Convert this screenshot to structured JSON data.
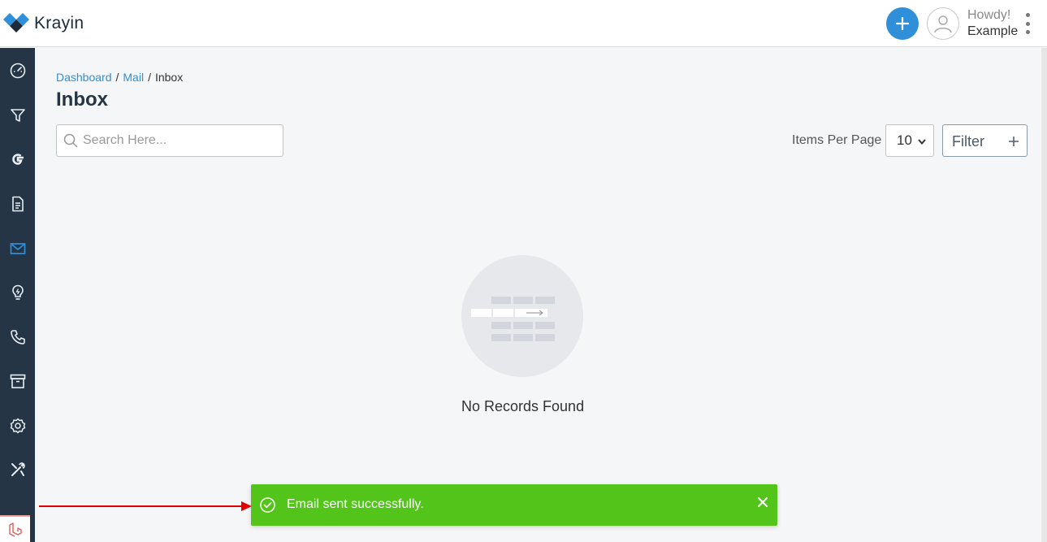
{
  "app": {
    "name": "Krayin"
  },
  "header": {
    "greeting": "Howdy!",
    "user": "Example"
  },
  "sidebar": {
    "items": [
      {
        "name": "dashboard",
        "icon": "speedometer-icon",
        "active": false
      },
      {
        "name": "leads",
        "icon": "funnel-icon",
        "active": false
      },
      {
        "name": "google",
        "icon": "google-icon",
        "active": false
      },
      {
        "name": "quotes",
        "icon": "document-icon",
        "active": false
      },
      {
        "name": "mail",
        "icon": "mail-icon",
        "active": true
      },
      {
        "name": "activities",
        "icon": "lightbulb-icon",
        "active": false
      },
      {
        "name": "contacts",
        "icon": "phone-icon",
        "active": false
      },
      {
        "name": "products",
        "icon": "archive-icon",
        "active": false
      },
      {
        "name": "settings",
        "icon": "gear-icon",
        "active": false
      },
      {
        "name": "configuration",
        "icon": "tools-icon",
        "active": false
      }
    ]
  },
  "breadcrumb": {
    "dashboard": "Dashboard",
    "mail": "Mail",
    "current": "Inbox"
  },
  "page": {
    "title": "Inbox"
  },
  "search": {
    "placeholder": "Search Here..."
  },
  "pagination": {
    "label": "Items Per Page",
    "value": "10"
  },
  "filter": {
    "label": "Filter"
  },
  "empty": {
    "text": "No Records Found"
  },
  "toast": {
    "message": "Email sent successfully."
  },
  "colors": {
    "accent": "#2f8fd8",
    "sidebar": "#253545",
    "success": "#52c41a",
    "annotation_arrow": "#e00000"
  }
}
